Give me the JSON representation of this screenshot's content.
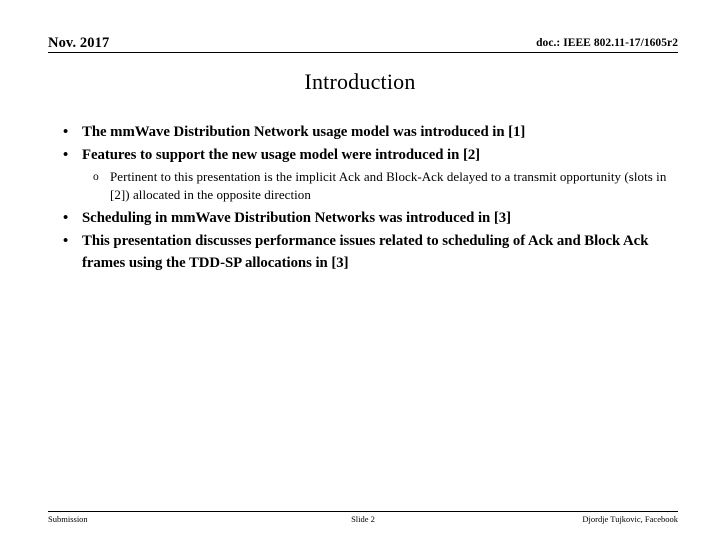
{
  "header": {
    "date": "Nov. 2017",
    "doc": "doc.: IEEE 802.11-17/1605r2"
  },
  "title": "Introduction",
  "bullets": [
    {
      "level": 1,
      "marker": "•",
      "text": "The mmWave Distribution Network usage model was introduced in [1]"
    },
    {
      "level": 1,
      "marker": "•",
      "text": "Features to support the new usage model were introduced in [2]"
    },
    {
      "level": 2,
      "marker": "o",
      "text": "Pertinent to this presentation is the implicit Ack and Block-Ack delayed to a transmit opportunity (slots in [2]) allocated in the opposite direction"
    },
    {
      "level": 1,
      "marker": "•",
      "text": "Scheduling in mmWave Distribution Networks was introduced in [3]"
    },
    {
      "level": 1,
      "marker": "•",
      "text": "This presentation discusses performance issues related to scheduling of Ack and Block Ack frames using the TDD-SP allocations in [3]"
    }
  ],
  "footer": {
    "left": "Submission",
    "middle": "Slide 2",
    "right": "Djordje Tujkovic, Facebook"
  }
}
